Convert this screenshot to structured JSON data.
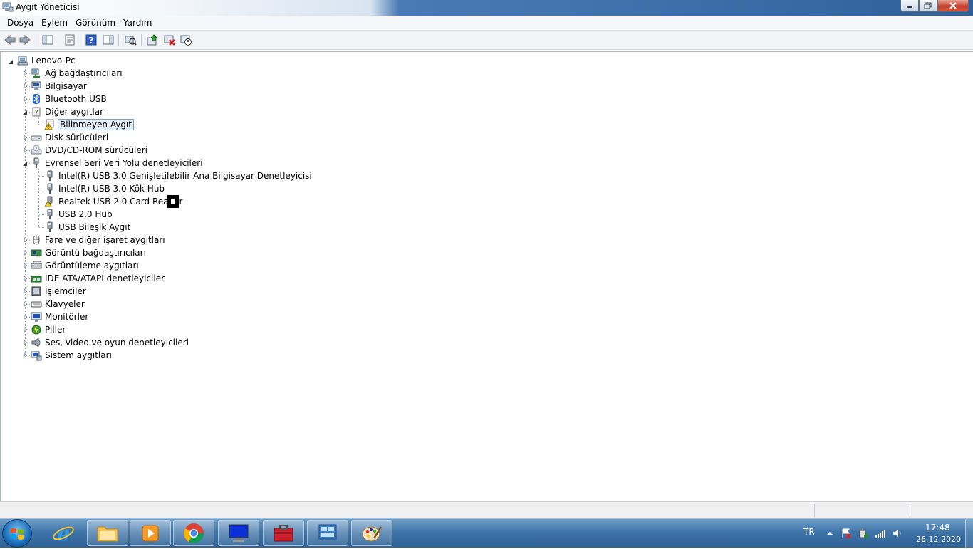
{
  "window": {
    "title": "Aygıt Yöneticisi"
  },
  "menu": {
    "items": [
      "Dosya",
      "Eylem",
      "Görünüm",
      "Yardım"
    ]
  },
  "tree": {
    "root": "Lenovo-Pc",
    "categories": [
      {
        "label": "Ağ bağdaştırıcıları",
        "icon": "network-adapter-icon",
        "expanded": false
      },
      {
        "label": "Bilgisayar",
        "icon": "computer-icon",
        "expanded": false
      },
      {
        "label": "Bluetooth USB",
        "icon": "bluetooth-icon",
        "expanded": false
      },
      {
        "label": "Diğer aygıtlar",
        "icon": "other-devices-icon",
        "expanded": true,
        "children": [
          {
            "label": "Bilinmeyen Aygıt",
            "icon": "unknown-device-warning-icon",
            "selected": true
          }
        ]
      },
      {
        "label": "Disk sürücüleri",
        "icon": "disk-drive-icon",
        "expanded": false
      },
      {
        "label": "DVD/CD-ROM sürücüleri",
        "icon": "dvd-drive-icon",
        "expanded": false
      },
      {
        "label": "Evrensel Seri Veri Yolu denetleyicileri",
        "icon": "usb-icon",
        "expanded": true,
        "children": [
          {
            "label": "Intel(R) USB 3.0 Genişletilebilir Ana Bilgisayar Denetleyicisi",
            "icon": "usb-icon"
          },
          {
            "label": "Intel(R) USB 3.0 Kök Hub",
            "icon": "usb-icon"
          },
          {
            "label": "Realtek USB 2.0 Card Reader",
            "icon": "usb-warning-icon"
          },
          {
            "label": "USB 2.0 Hub",
            "icon": "usb-icon"
          },
          {
            "label": "USB Bileşik Aygıt",
            "icon": "usb-icon"
          }
        ]
      },
      {
        "label": "Fare ve diğer işaret aygıtları",
        "icon": "mouse-icon",
        "expanded": false
      },
      {
        "label": "Görüntü bağdaştırıcıları",
        "icon": "display-adapter-icon",
        "expanded": false
      },
      {
        "label": "Görüntüleme aygıtları",
        "icon": "imaging-device-icon",
        "expanded": false
      },
      {
        "label": "IDE ATA/ATAPI denetleyiciler",
        "icon": "ide-controller-icon",
        "expanded": false
      },
      {
        "label": "İşlemciler",
        "icon": "processor-icon",
        "expanded": false
      },
      {
        "label": "Klavyeler",
        "icon": "keyboard-icon",
        "expanded": false
      },
      {
        "label": "Monitörler",
        "icon": "monitor-icon",
        "expanded": false
      },
      {
        "label": "Piller",
        "icon": "battery-icon",
        "expanded": false
      },
      {
        "label": "Ses, video ve oyun denetleyicileri",
        "icon": "sound-icon",
        "expanded": false
      },
      {
        "label": "Sistem aygıtları",
        "icon": "system-devices-icon",
        "expanded": false
      }
    ]
  },
  "taskbar": {
    "apps": [
      "internet-explorer-icon",
      "file-explorer-icon",
      "media-player-icon",
      "chrome-icon",
      "remote-desktop-icon",
      "toolbox-icon",
      "control-panel-icon",
      "paint-icon"
    ],
    "language": "TR",
    "time": "17:48",
    "date": "26.12.2020"
  }
}
